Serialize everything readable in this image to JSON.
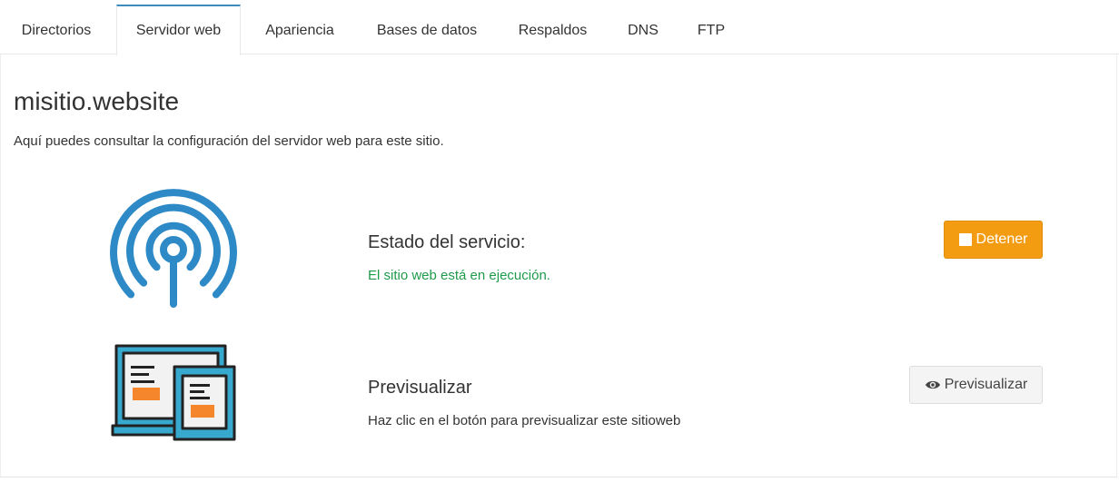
{
  "tabs": [
    {
      "label": "Directorios",
      "active": false
    },
    {
      "label": "Servidor web",
      "active": true
    },
    {
      "label": "Apariencia",
      "active": false
    },
    {
      "label": "Bases de datos",
      "active": false
    },
    {
      "label": "Respaldos",
      "active": false
    },
    {
      "label": "DNS",
      "active": false
    },
    {
      "label": "FTP",
      "active": false
    }
  ],
  "site": {
    "title": "misitio.website",
    "description": "Aquí puedes consultar la configuración del servidor web para este sitio."
  },
  "service": {
    "icon": "broadcast-icon",
    "title": "Estado del servicio:",
    "status": "El sitio web está en ejecución.",
    "status_color": "#1e9b4a",
    "stop_label": "Detener",
    "stop_color": "#f39c12"
  },
  "preview": {
    "icon": "devices-icon",
    "title": "Previsualizar",
    "text": "Haz clic en el botón para previsualizar este sitioweb",
    "button_label": "Previsualizar"
  },
  "colors": {
    "accent": "#3c8dbc",
    "icon_blue": "#2e8ac6",
    "icon_orange": "#f5862b"
  }
}
